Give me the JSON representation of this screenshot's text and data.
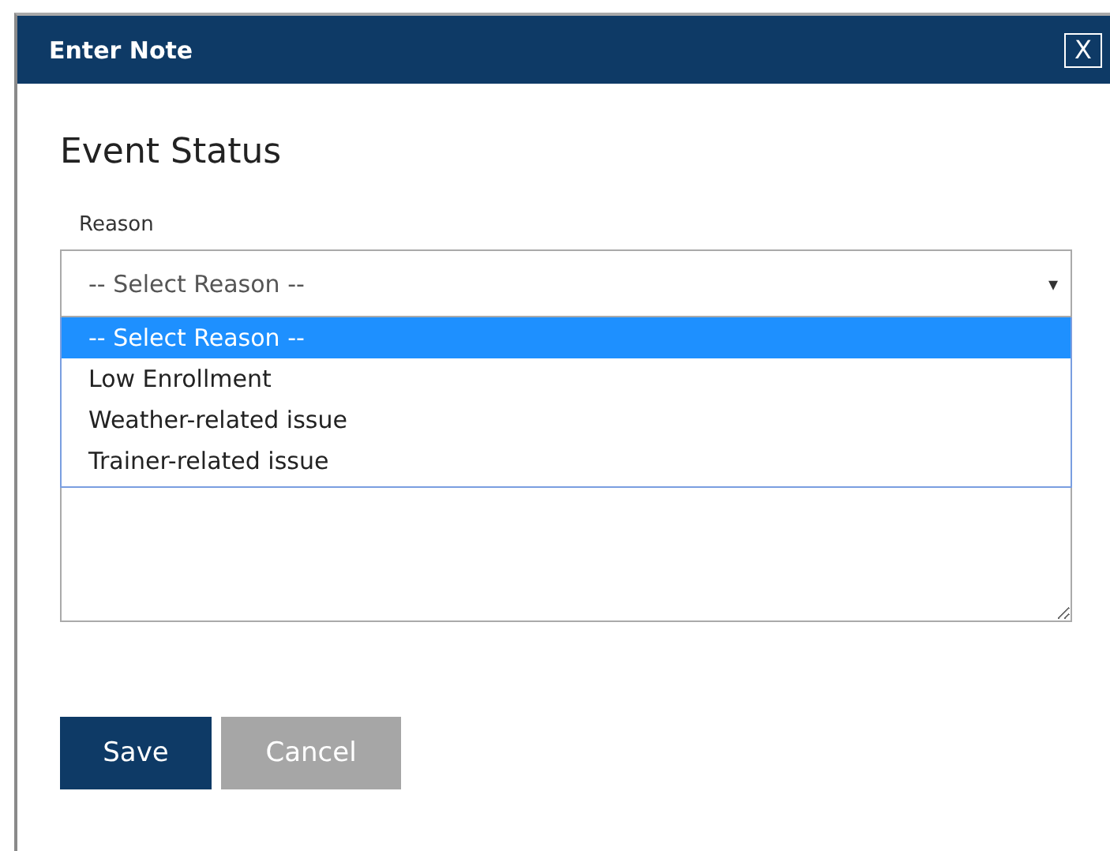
{
  "dialog": {
    "title": "Enter Note",
    "close": "X"
  },
  "heading": "Event Status",
  "reason": {
    "label": "Reason",
    "value": "-- Select Reason --",
    "caret": "▾",
    "options": [
      {
        "label": "-- Select Reason --",
        "selected": true
      },
      {
        "label": "Low Enrollment",
        "selected": false
      },
      {
        "label": "Weather-related issue",
        "selected": false
      },
      {
        "label": "Trainer-related issue",
        "selected": false
      }
    ]
  },
  "note": {
    "kind": "textarea"
  },
  "buttons": [
    {
      "label": "Save",
      "kind": "primary"
    },
    {
      "label": "Cancel",
      "kind": "secondary"
    }
  ]
}
